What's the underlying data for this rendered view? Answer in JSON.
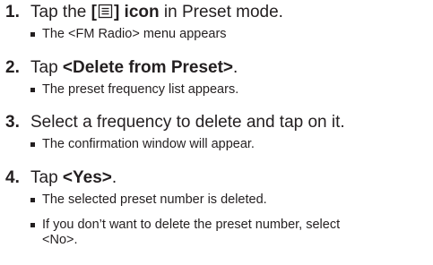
{
  "steps": [
    {
      "number": "1.",
      "pre": "Tap the ",
      "bold_open": "[",
      "icon": "list-menu-icon",
      "bold_close": "] icon",
      "post": " in Preset mode.",
      "notes": [
        "The <FM Radio> menu appears"
      ]
    },
    {
      "number": "2.",
      "pre": "Tap ",
      "bold": "<Delete from Preset>",
      "post": ".",
      "notes": [
        "The preset frequency list appears."
      ]
    },
    {
      "number": "3.",
      "text": "Select a frequency to delete and tap on it.",
      "notes": [
        "The confirmation window will appear."
      ]
    },
    {
      "number": "4.",
      "pre": "Tap ",
      "bold": "<Yes>",
      "post": ".",
      "notes": [
        "The selected preset number is deleted.",
        "If you don’t want to delete the preset number, select",
        "<No>."
      ]
    }
  ]
}
